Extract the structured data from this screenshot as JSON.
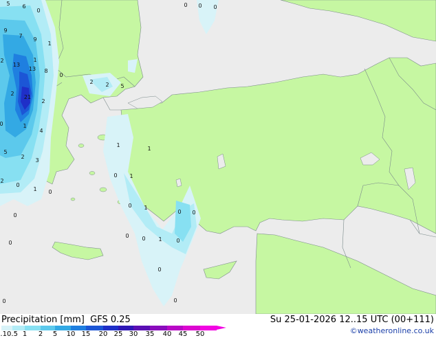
{
  "map": {
    "colors": {
      "land": "#c6f7a2",
      "sea": "#ececec",
      "border": "#7a8a8a"
    },
    "point_labels": [
      "5",
      "6",
      "0",
      "0",
      "0",
      "0",
      "9",
      "7",
      "9",
      "1",
      "2",
      "13",
      "1",
      "13",
      "8",
      "2",
      "2",
      "2",
      "2",
      "21",
      "0",
      "1",
      "4",
      "5",
      "2",
      "3",
      "5",
      "0",
      "1",
      "1",
      "2",
      "0",
      "1",
      "0",
      "0",
      "1",
      "0",
      "0",
      "1",
      "0",
      "0",
      "0",
      "0",
      "1",
      "0",
      "0",
      "0",
      "0",
      "0"
    ]
  },
  "legend": {
    "title": "Precipitation [mm]  GFS 0.25",
    "datetime": "Su 25-01-2026 12..15 UTC (00+111)",
    "credit": "©weatheronline.co.uk",
    "bins": [
      {
        "label": "0.1",
        "color": "#d8f3f8"
      },
      {
        "label": "0.5",
        "color": "#b2ecf6"
      },
      {
        "label": "1",
        "color": "#87e0f2"
      },
      {
        "label": "2",
        "color": "#5cc9ec"
      },
      {
        "label": "5",
        "color": "#33a9e4"
      },
      {
        "label": "10",
        "color": "#1f7fe0"
      },
      {
        "label": "15",
        "color": "#1c56d6"
      },
      {
        "label": "20",
        "color": "#1f2fc8"
      },
      {
        "label": "25",
        "color": "#2e17b6"
      },
      {
        "label": "30",
        "color": "#5a0fb4"
      },
      {
        "label": "35",
        "color": "#8a0cbc"
      },
      {
        "label": "40",
        "color": "#b808c6"
      },
      {
        "label": "45",
        "color": "#dc06d0"
      },
      {
        "label": "50",
        "color": "#f205e2"
      }
    ]
  }
}
